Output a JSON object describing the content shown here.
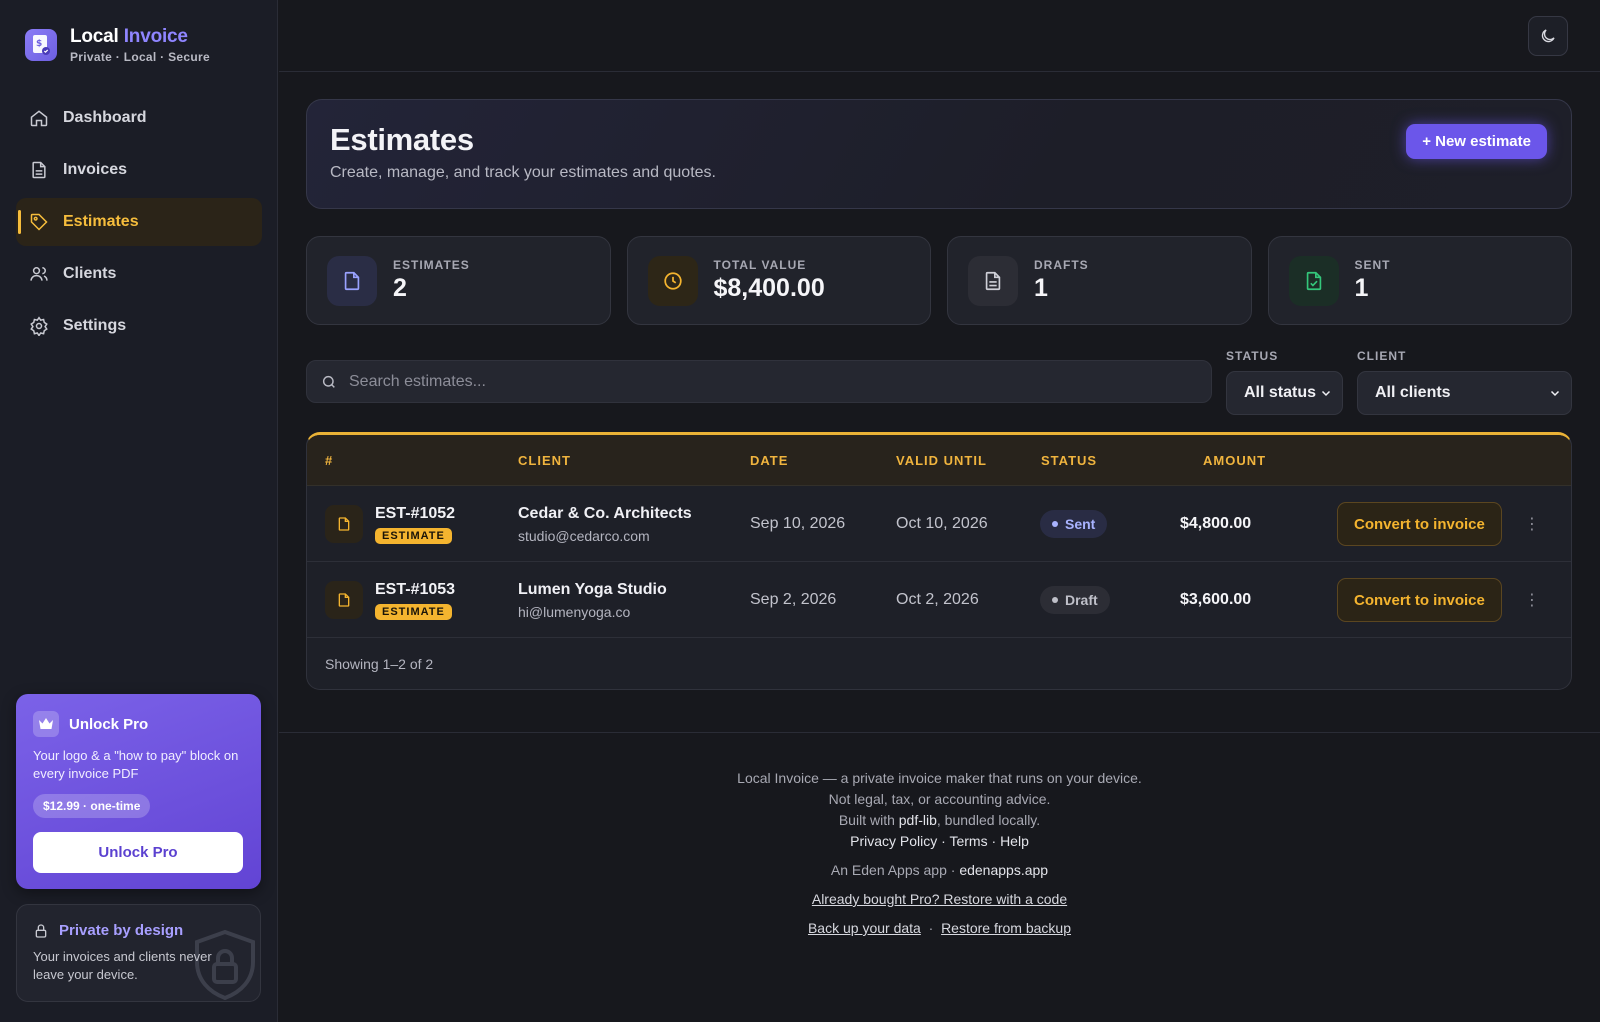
{
  "brand": {
    "title_main": "Local",
    "title_accent": "Invoice",
    "subtitle": "Private · Local · Secure"
  },
  "nav": {
    "items": [
      {
        "label": "Dashboard",
        "icon": "home-icon",
        "active": false
      },
      {
        "label": "Invoices",
        "icon": "file-icon",
        "active": false
      },
      {
        "label": "Estimates",
        "icon": "tag-icon",
        "active": true
      },
      {
        "label": "Clients",
        "icon": "users-icon",
        "active": false
      },
      {
        "label": "Settings",
        "icon": "gear-icon",
        "active": false
      }
    ]
  },
  "pro": {
    "title": "Unlock Pro",
    "description": "Your logo & a \"how to pay\" block on every invoice PDF",
    "price": "$12.99 · one-time",
    "button": "Unlock Pro"
  },
  "private": {
    "title": "Private by design",
    "description": "Your invoices and clients never leave your device."
  },
  "header": {
    "title": "Estimates",
    "subtitle": "Create, manage, and track your estimates and quotes.",
    "new_button": "+ New estimate"
  },
  "stats": [
    {
      "label": "ESTIMATES",
      "value": "2",
      "icon": "file-icon",
      "color": "#8b93ff"
    },
    {
      "label": "TOTAL VALUE",
      "value": "$8,400.00",
      "icon": "clock-icon",
      "color": "#f4b42f"
    },
    {
      "label": "DRAFTS",
      "value": "1",
      "icon": "document-text-icon",
      "color": "#c8c9d2"
    },
    {
      "label": "SENT",
      "value": "1",
      "icon": "file-check-icon",
      "color": "#34c77b"
    }
  ],
  "search": {
    "placeholder": "Search estimates..."
  },
  "filters": {
    "status_label": "STATUS",
    "status_value": "All status",
    "client_label": "CLIENT",
    "client_value": "All clients"
  },
  "table": {
    "columns": [
      "#",
      "CLIENT",
      "DATE",
      "VALID UNTIL",
      "STATUS",
      "AMOUNT"
    ],
    "rows": [
      {
        "number": "EST-#1052",
        "tag": "ESTIMATE",
        "client": "Cedar & Co. Architects",
        "email": "studio@cedarco.com",
        "date": "Sep 10, 2026",
        "valid_until": "Oct 10, 2026",
        "status": "Sent",
        "amount": "$4,800.00",
        "action": "Convert to invoice"
      },
      {
        "number": "EST-#1053",
        "tag": "ESTIMATE",
        "client": "Lumen Yoga Studio",
        "email": "hi@lumenyoga.co",
        "date": "Sep 2, 2026",
        "valid_until": "Oct 2, 2026",
        "status": "Draft",
        "amount": "$3,600.00",
        "action": "Convert to invoice"
      }
    ],
    "footer": "Showing 1–2 of 2"
  },
  "footer": {
    "line1": "Local Invoice — a private invoice maker that runs on your device.",
    "line2": "Not legal, tax, or accounting advice.",
    "built_prefix": "Built with ",
    "built_lib": "pdf-lib",
    "built_suffix": ", bundled locally.",
    "privacy": "Privacy Policy",
    "terms": "Terms",
    "help": "Help",
    "eden_prefix": "An Eden Apps app · ",
    "eden_link": "edenapps.app",
    "restore_code": "Already bought Pro? Restore with a code",
    "backup": "Back up your data",
    "restore_backup": "Restore from backup"
  },
  "colors": {
    "accent": "#6b56ea",
    "warning": "#f4b42f",
    "background": "#17181d"
  }
}
